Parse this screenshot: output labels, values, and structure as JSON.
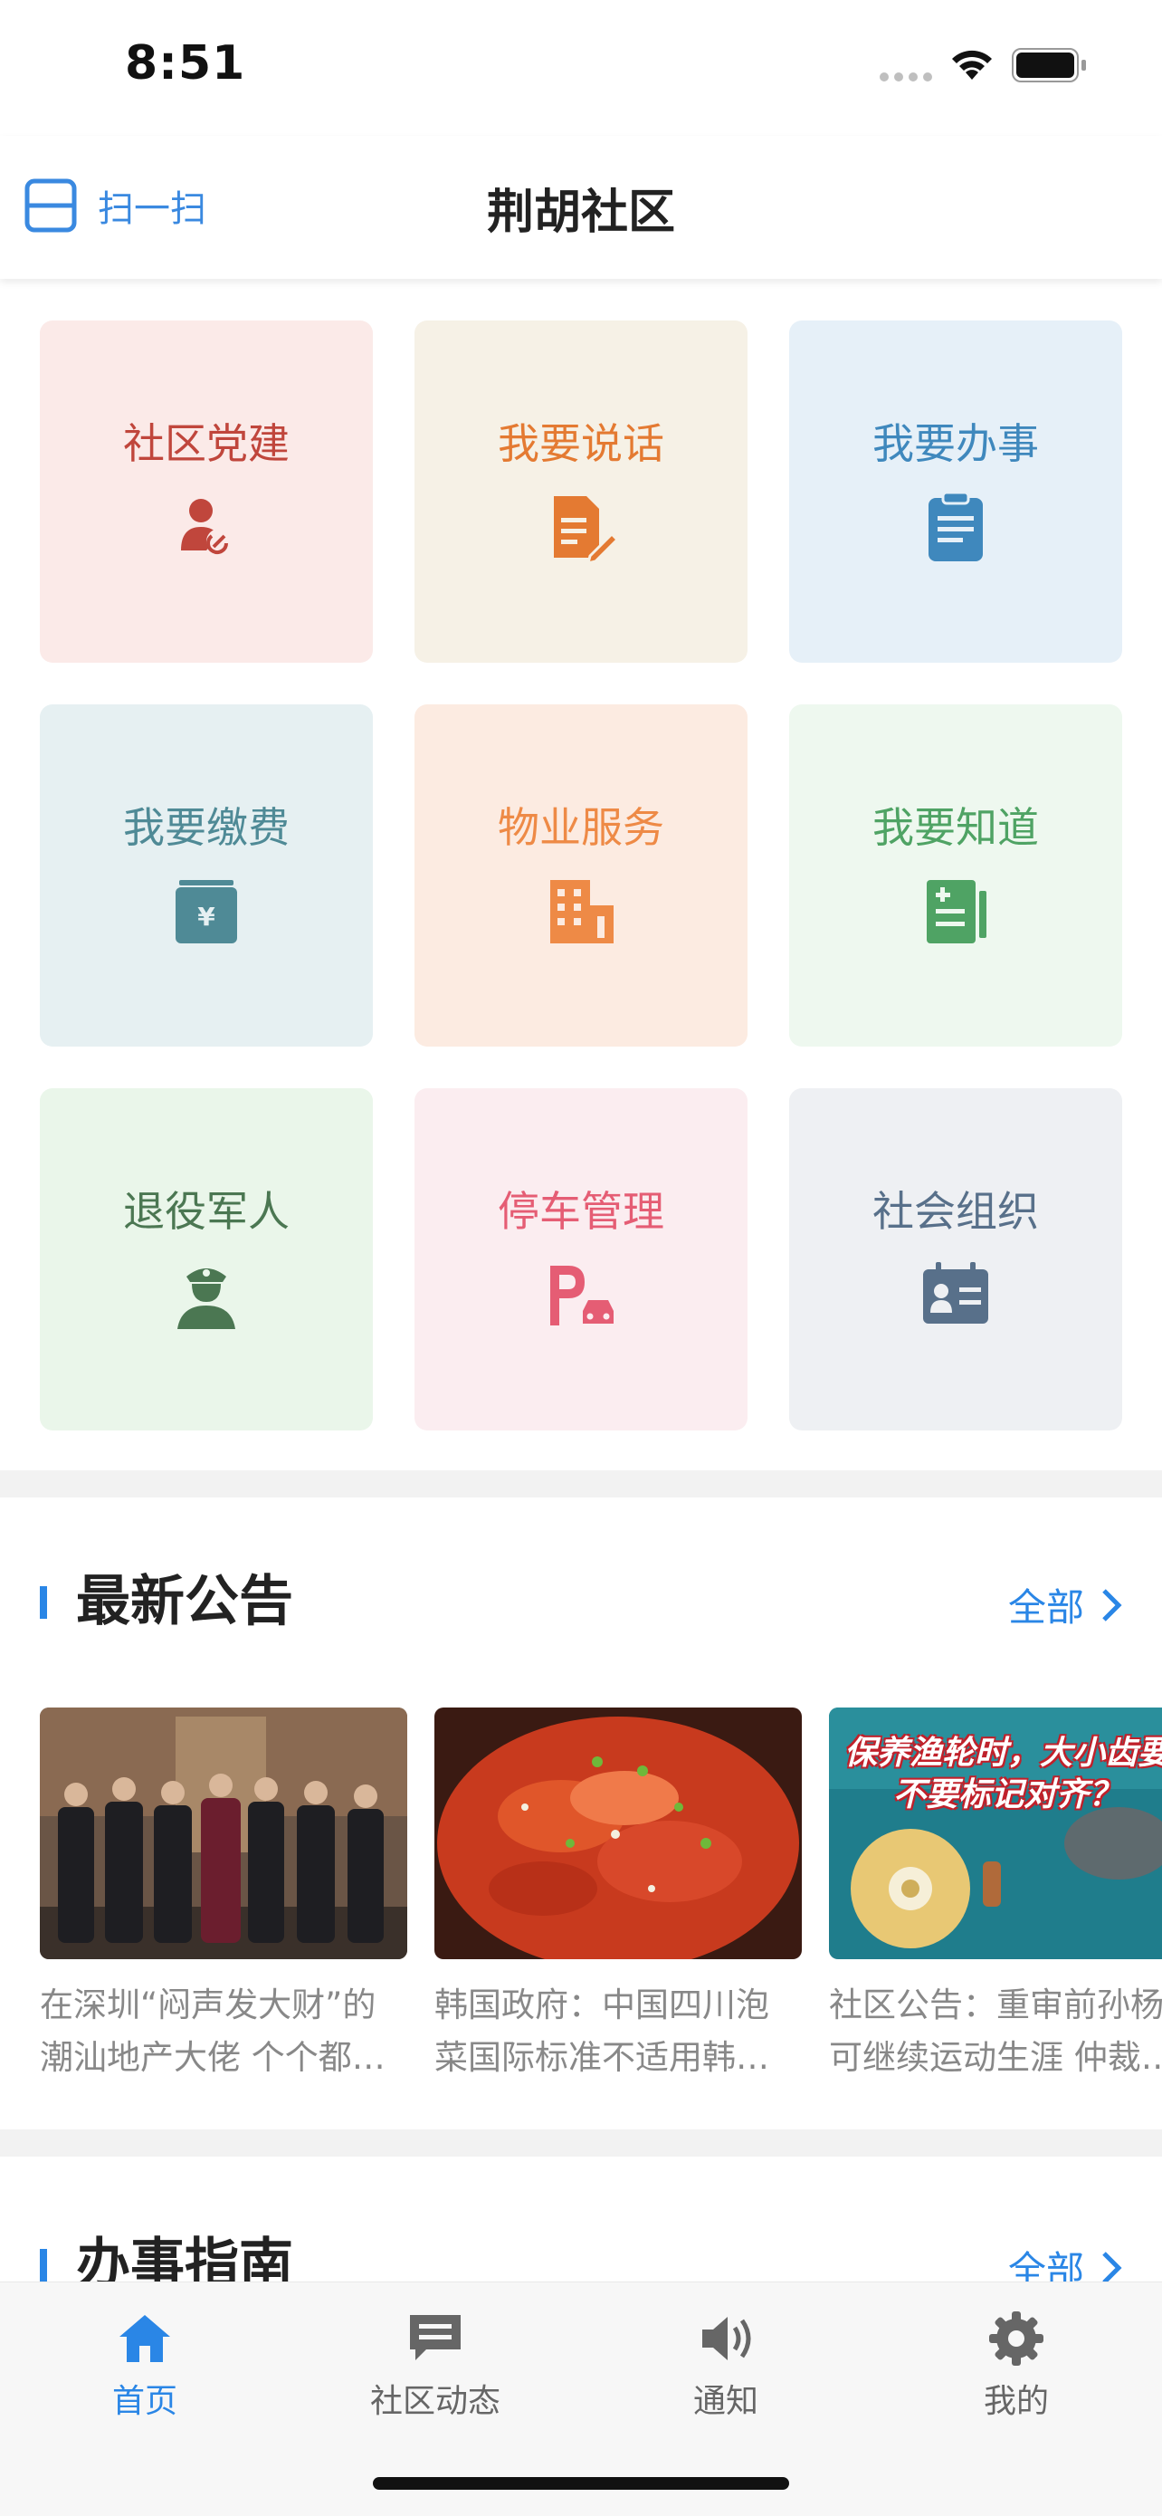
{
  "status": {
    "time": "8:51"
  },
  "nav": {
    "scan_label": "扫一扫",
    "title": "荆胡社区"
  },
  "tiles": [
    {
      "label": "社区党建",
      "icon": "party-member-icon",
      "bg": "#fbeae8",
      "color": "#c0463c"
    },
    {
      "label": "我要说话",
      "icon": "document-edit-icon",
      "bg": "#f6f1e6",
      "color": "#e47a32"
    },
    {
      "label": "我要办事",
      "icon": "clipboard-icon",
      "bg": "#e6f0f8",
      "color": "#3f88bd"
    },
    {
      "label": "我要缴费",
      "icon": "payment-icon",
      "bg": "#e6f0f2",
      "color": "#4f8a96"
    },
    {
      "label": "物业服务",
      "icon": "building-icon",
      "bg": "#fcebe1",
      "color": "#ee8a46"
    },
    {
      "label": "我要知道",
      "icon": "notebook-icon",
      "bg": "#eef8ef",
      "color": "#4fa364"
    },
    {
      "label": "退役军人",
      "icon": "soldier-icon",
      "bg": "#eaf6ea",
      "color": "#4b7752"
    },
    {
      "label": "停车管理",
      "icon": "parking-icon",
      "bg": "#fbedf0",
      "color": "#e55d74"
    },
    {
      "label": "社会组织",
      "icon": "id-card-icon",
      "bg": "#eef0f3",
      "color": "#58708a"
    }
  ],
  "announcements": {
    "title": "最新公告",
    "all_label": "全部",
    "items": [
      {
        "text": "在深圳“闷声发大财”的潮汕地产大佬 个个都…"
      },
      {
        "text": "韩国政府：中国四川泡菜国际标准不适用韩…"
      },
      {
        "text": "社区公告：重审前孙杨可继续运动生涯 仲裁…",
        "banner": "保养渔轮时，大小齿要不要标记对齐？"
      }
    ]
  },
  "guide": {
    "title": "办事指南",
    "all_label": "全部"
  },
  "tabbar": {
    "items": [
      {
        "label": "首页",
        "icon": "home-icon"
      },
      {
        "label": "社区动态",
        "icon": "chat-icon"
      },
      {
        "label": "通知",
        "icon": "speaker-icon"
      },
      {
        "label": "我的",
        "icon": "gear-icon"
      }
    ]
  },
  "colors": {
    "accent": "#2a86e6"
  }
}
